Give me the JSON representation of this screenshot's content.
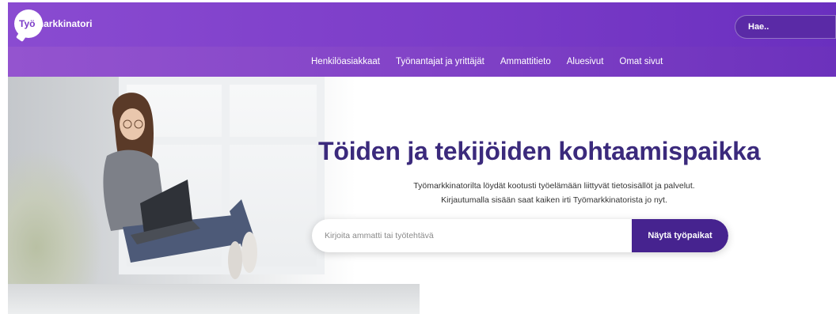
{
  "header": {
    "logo_prefix": "Työ",
    "logo_rest": "markkinatori",
    "search_label": "Hae.."
  },
  "nav": {
    "items": [
      {
        "label": "Henkilöasiakkaat"
      },
      {
        "label": "Työnantajat ja yrittäjät"
      },
      {
        "label": "Ammattitieto"
      },
      {
        "label": "Aluesivut"
      },
      {
        "label": "Omat sivut"
      }
    ]
  },
  "hero": {
    "title": "Töiden ja tekijöiden kohtaamispaikka",
    "subtitle_line1": "Työmarkkinatorilta löydät kootusti työelämään liittyvät tietosisällöt ja palvelut.",
    "subtitle_line2": "Kirjautumalla sisään saat kaiken irti Työmarkkinatorista jo nyt.",
    "search": {
      "placeholder": "Kirjoita ammatti tai työtehtävä",
      "button_label": "Näytä työpaikat"
    }
  },
  "colors": {
    "brand_purple": "#7b3cc8",
    "headline": "#3b2a7c",
    "button": "#46238f"
  }
}
